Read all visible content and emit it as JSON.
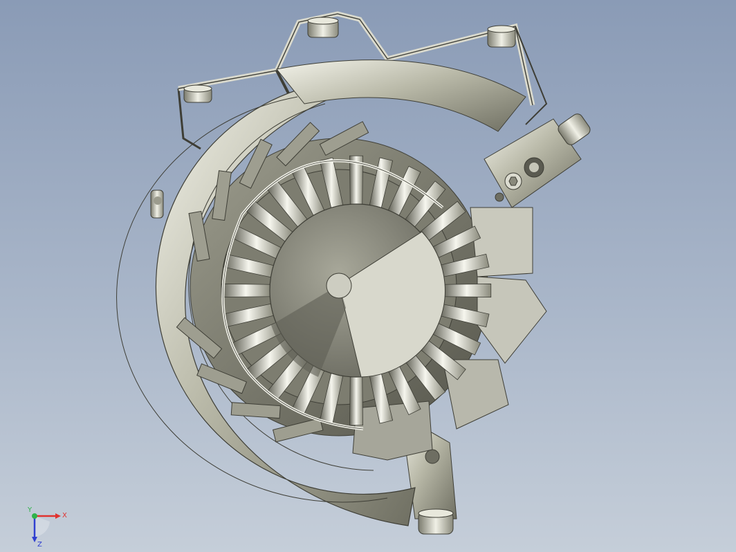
{
  "viewport": {
    "name": "3d-cad-viewport"
  },
  "model": {
    "blade_count": 28
  },
  "triad": {
    "x_label": "X",
    "y_label": "Y",
    "z_label": "Z",
    "colors": {
      "x": "#e0322f",
      "y": "#2fb34a",
      "z": "#2f3fd0"
    }
  }
}
